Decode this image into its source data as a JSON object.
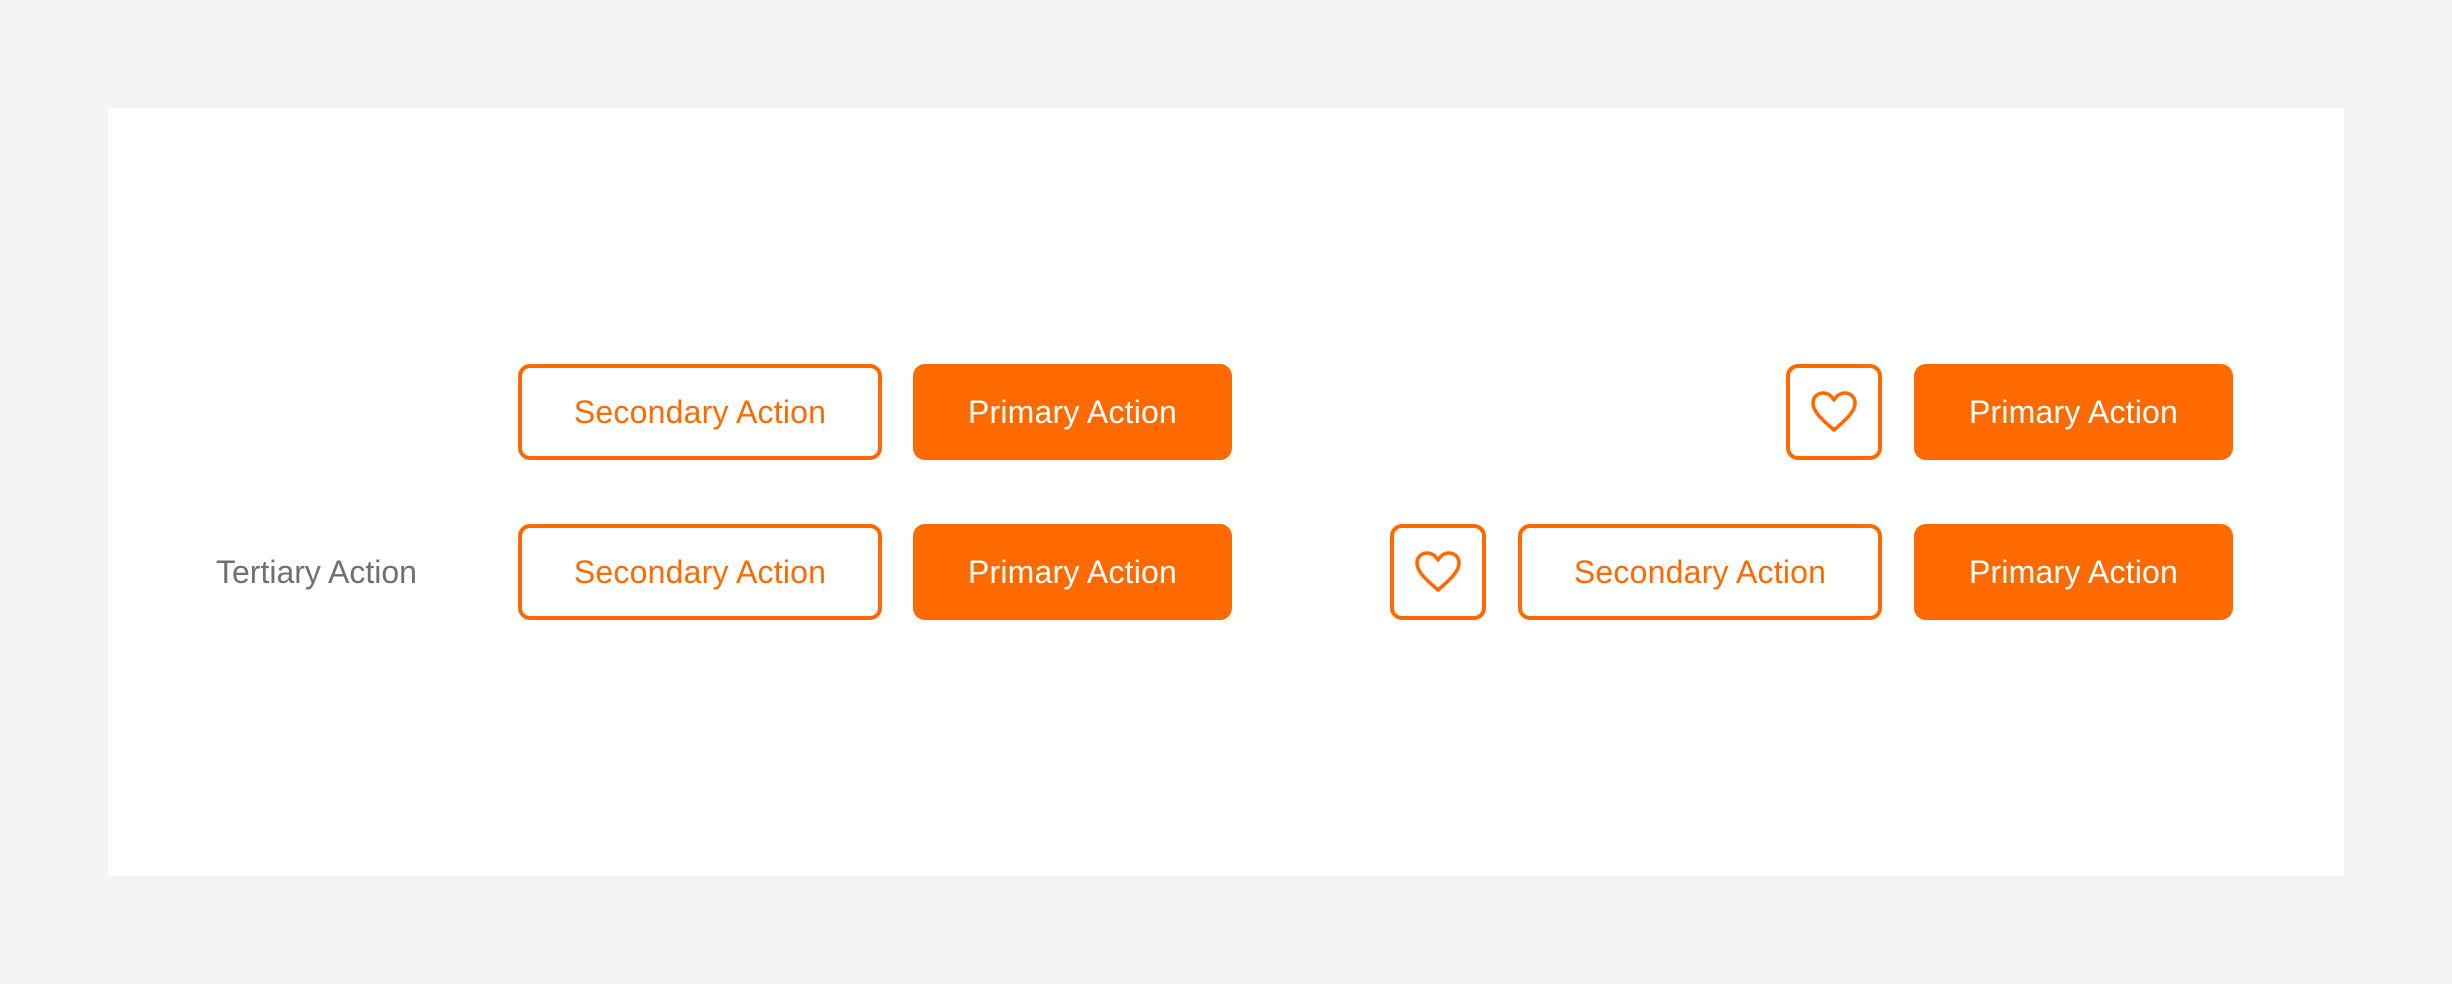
{
  "colors": {
    "accent": "#ff6a00",
    "page_background": "#f4f4f4",
    "card_background": "#ffffff",
    "tertiary_text": "#707070"
  },
  "left_group": {
    "row1": {
      "secondary_label": "Secondary Action",
      "primary_label": "Primary Action"
    },
    "row2": {
      "tertiary_label": "Tertiary Action",
      "secondary_label": "Secondary Action",
      "primary_label": "Primary Action"
    }
  },
  "right_group": {
    "row1": {
      "icon": "heart-icon",
      "primary_label": "Primary Action"
    },
    "row2": {
      "icon": "heart-icon",
      "secondary_label": "Secondary Action",
      "primary_label": "Primary Action"
    }
  }
}
